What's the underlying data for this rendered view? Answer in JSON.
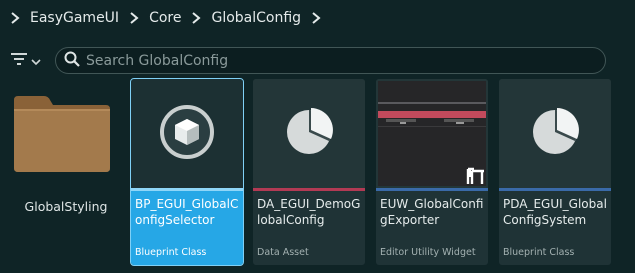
{
  "breadcrumb": {
    "items": [
      "EasyGameUI",
      "Core",
      "GlobalConfig"
    ]
  },
  "search": {
    "placeholder": "Search GlobalConfig",
    "value": ""
  },
  "folder": {
    "label": "GlobalStyling"
  },
  "assets": [
    {
      "name": "BP_EGUI_GlobalConfigSelector",
      "type": "Blueprint Class",
      "strip_color": "#26a7e6",
      "selected": true
    },
    {
      "name": "DA_EGUI_DemoGlobalConfig",
      "type": "Data Asset",
      "strip_color": "#b23a54",
      "selected": false
    },
    {
      "name": "EUW_GlobalConfigExporter",
      "type": "Editor Utility Widget",
      "strip_color": "#3a6aa8",
      "selected": false
    },
    {
      "name": "PDA_EGUI_GlobalConfigSystem",
      "type": "Blueprint Class",
      "strip_color": "#3a6aa8",
      "selected": false
    }
  ],
  "colors": {
    "background": "#0f2426",
    "selection": "#26a7e6",
    "folder": "#a37a4c"
  }
}
